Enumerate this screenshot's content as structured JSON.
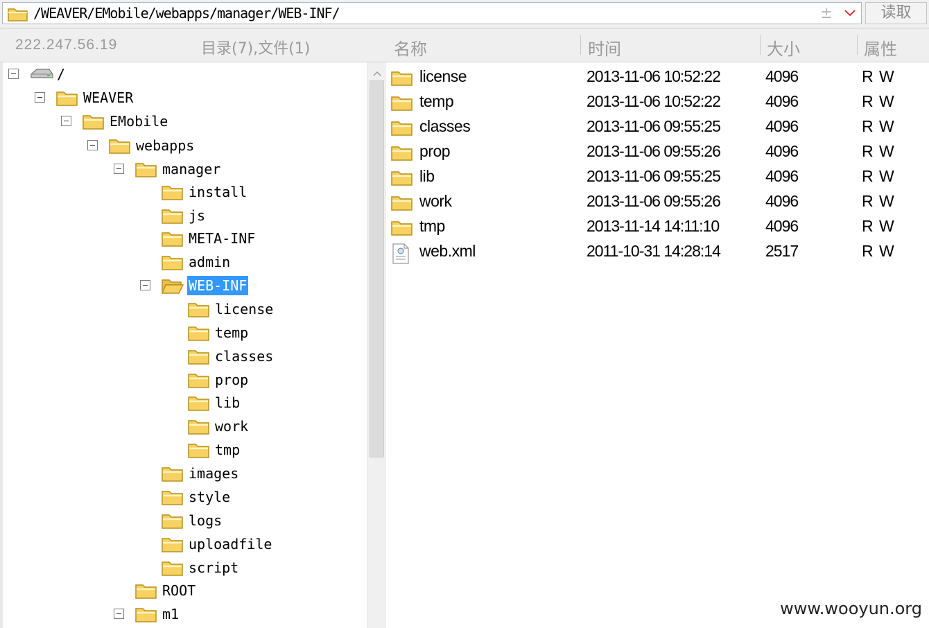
{
  "address_bar": {
    "path": "/WEAVER/EMobile/webapps/manager/WEB-INF/",
    "add_glyph": "±",
    "read_button": "读取"
  },
  "header": {
    "ip": "222.247.56.19",
    "count": "目录(7),文件(1)",
    "columns": {
      "name": "名称",
      "time": "时间",
      "size": "大小",
      "attr": "属性"
    }
  },
  "tree": [
    {
      "label": "/",
      "kind": "drive",
      "expanded": true
    },
    {
      "label": "WEAVER",
      "kind": "folder",
      "expanded": true
    },
    {
      "label": "EMobile",
      "kind": "folder",
      "expanded": true
    },
    {
      "label": "webapps",
      "kind": "folder",
      "expanded": true
    },
    {
      "label": "manager",
      "kind": "folder",
      "expanded": true
    },
    {
      "label": "install",
      "kind": "folder"
    },
    {
      "label": "js",
      "kind": "folder"
    },
    {
      "label": "META-INF",
      "kind": "folder"
    },
    {
      "label": "admin",
      "kind": "folder"
    },
    {
      "label": "WEB-INF",
      "kind": "folder-open",
      "expanded": true,
      "selected": true
    },
    {
      "label": "license",
      "kind": "folder"
    },
    {
      "label": "temp",
      "kind": "folder"
    },
    {
      "label": "classes",
      "kind": "folder"
    },
    {
      "label": "prop",
      "kind": "folder"
    },
    {
      "label": "lib",
      "kind": "folder"
    },
    {
      "label": "work",
      "kind": "folder"
    },
    {
      "label": "tmp",
      "kind": "folder"
    },
    {
      "label": "images",
      "kind": "folder"
    },
    {
      "label": "style",
      "kind": "folder"
    },
    {
      "label": "logs",
      "kind": "folder"
    },
    {
      "label": "uploadfile",
      "kind": "folder"
    },
    {
      "label": "script",
      "kind": "folder"
    },
    {
      "label": "ROOT",
      "kind": "folder"
    },
    {
      "label": "m1",
      "kind": "folder",
      "expanded": true
    }
  ],
  "files": [
    {
      "name": "license",
      "time": "2013-11-06 10:52:22",
      "size": "4096",
      "attr": "R W",
      "icon": "folder-icon"
    },
    {
      "name": "temp",
      "time": "2013-11-06 10:52:22",
      "size": "4096",
      "attr": "R W",
      "icon": "folder-icon"
    },
    {
      "name": "classes",
      "time": "2013-11-06 09:55:25",
      "size": "4096",
      "attr": "R W",
      "icon": "folder-icon"
    },
    {
      "name": "prop",
      "time": "2013-11-06 09:55:26",
      "size": "4096",
      "attr": "R W",
      "icon": "folder-icon"
    },
    {
      "name": "lib",
      "time": "2013-11-06 09:55:25",
      "size": "4096",
      "attr": "R W",
      "icon": "folder-icon"
    },
    {
      "name": "work",
      "time": "2013-11-06 09:55:26",
      "size": "4096",
      "attr": "R W",
      "icon": "folder-icon"
    },
    {
      "name": "tmp",
      "time": "2013-11-14 14:11:10",
      "size": "4096",
      "attr": "R W",
      "icon": "folder-icon"
    },
    {
      "name": "web.xml",
      "time": "2011-10-31 14:28:14",
      "size": "2517",
      "attr": "R W",
      "icon": "xml-file-icon"
    }
  ],
  "watermark": "www.wooyun.org",
  "colors": {
    "selection": "#3399ff",
    "folder": "#f7d262",
    "folder_outline": "#b8911e",
    "header_text": "#9a9a9a",
    "dropdown": "#e03030"
  }
}
